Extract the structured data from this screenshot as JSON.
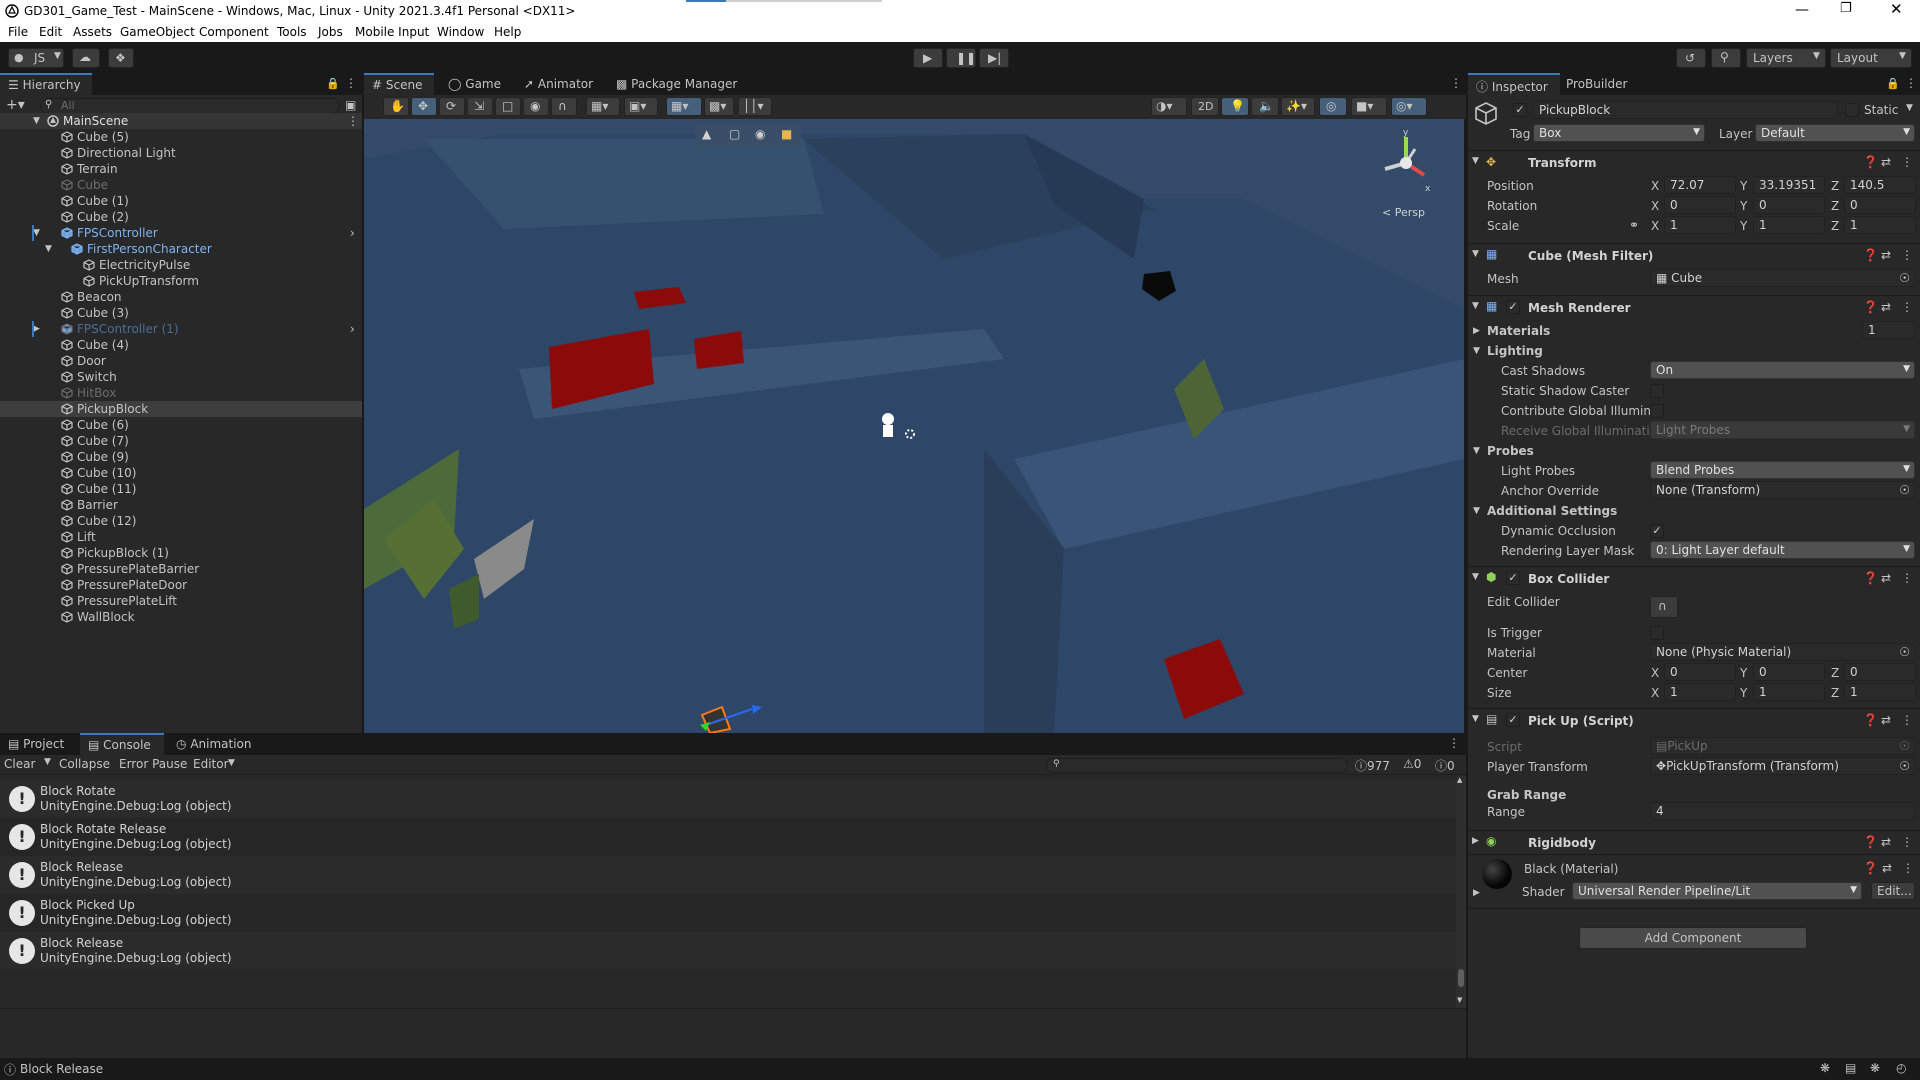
{
  "window": {
    "title": "GD301_Game_Test - MainScene - Windows, Mac, Linux - Unity 2021.3.4f1 Personal <DX11>"
  },
  "menu": [
    "File",
    "Edit",
    "Assets",
    "GameObject",
    "Component",
    "Tools",
    "Jobs",
    "Mobile Input",
    "Window",
    "Help"
  ],
  "toolbar": {
    "account": "JS",
    "layers": "Layers",
    "layout": "Layout"
  },
  "hierarchy": {
    "title": "Hierarchy",
    "search_placeholder": "All",
    "scene": "MainScene",
    "items": [
      {
        "label": "Cube (5)",
        "depth": 1
      },
      {
        "label": "Directional Light",
        "depth": 1
      },
      {
        "label": "Terrain",
        "depth": 1
      },
      {
        "label": "Cube",
        "depth": 1,
        "disabled": true
      },
      {
        "label": "Cube (1)",
        "depth": 1
      },
      {
        "label": "Cube (2)",
        "depth": 1
      },
      {
        "label": "FPSController",
        "depth": 1,
        "prefab": true,
        "expanded": true
      },
      {
        "label": "FirstPersonCharacter",
        "depth": 2,
        "prefab": true,
        "expanded": true
      },
      {
        "label": "ElectricityPulse",
        "depth": 3
      },
      {
        "label": "PickUpTransform",
        "depth": 3
      },
      {
        "label": "Beacon",
        "depth": 1
      },
      {
        "label": "Cube (3)",
        "depth": 1
      },
      {
        "label": "FPSController (1)",
        "depth": 1,
        "prefab": true,
        "disabled": true,
        "collapsed": true
      },
      {
        "label": "Cube (4)",
        "depth": 1
      },
      {
        "label": "Door",
        "depth": 1
      },
      {
        "label": "Switch",
        "depth": 1
      },
      {
        "label": "HitBox",
        "depth": 1,
        "disabled": true
      },
      {
        "label": "PickupBlock",
        "depth": 1,
        "selected": true
      },
      {
        "label": "Cube (6)",
        "depth": 1
      },
      {
        "label": "Cube (7)",
        "depth": 1
      },
      {
        "label": "Cube (9)",
        "depth": 1
      },
      {
        "label": "Cube (10)",
        "depth": 1
      },
      {
        "label": "Cube (11)",
        "depth": 1
      },
      {
        "label": "Barrier",
        "depth": 1
      },
      {
        "label": "Cube (12)",
        "depth": 1
      },
      {
        "label": "Lift",
        "depth": 1
      },
      {
        "label": "PickupBlock (1)",
        "depth": 1
      },
      {
        "label": "PressurePlateBarrier",
        "depth": 1
      },
      {
        "label": "PressurePlateDoor",
        "depth": 1
      },
      {
        "label": "PressurePlateLift",
        "depth": 1
      },
      {
        "label": "WallBlock",
        "depth": 1
      }
    ]
  },
  "scene_tabs": {
    "scene": "Scene",
    "game": "Game",
    "animator": "Animator",
    "package_manager": "Package Manager"
  },
  "scene_view": {
    "mode_2d": "2D",
    "persp": "< Persp",
    "gizmo_y": "y",
    "gizmo_x": "x"
  },
  "bottom_tabs": {
    "project": "Project",
    "console": "Console",
    "animation": "Animation"
  },
  "console": {
    "clear": "Clear",
    "collapse": "Collapse",
    "error_pause": "Error Pause",
    "editor": "Editor",
    "log_count": "977",
    "warn_count": "0",
    "error_count": "0",
    "entries": [
      {
        "title": "Block Rotate",
        "detail": "UnityEngine.Debug:Log (object)"
      },
      {
        "title": "Block Rotate Release",
        "detail": "UnityEngine.Debug:Log (object)"
      },
      {
        "title": "Block Release",
        "detail": "UnityEngine.Debug:Log (object)"
      },
      {
        "title": "Block Picked Up",
        "detail": "UnityEngine.Debug:Log (object)"
      },
      {
        "title": "Block Release",
        "detail": "UnityEngine.Debug:Log (object)"
      }
    ]
  },
  "status_bar": {
    "message": "Block Release"
  },
  "inspector": {
    "tab_inspector": "Inspector",
    "tab_probuilder": "ProBuilder",
    "object_name": "PickupBlock",
    "static": "Static",
    "tag_label": "Tag",
    "tag": "Box",
    "layer_label": "Layer",
    "layer": "Default",
    "transform": {
      "title": "Transform",
      "position_label": "Position",
      "rotation_label": "Rotation",
      "scale_label": "Scale",
      "position": {
        "x": "72.07",
        "y": "33.19351",
        "z": "140.5"
      },
      "rotation": {
        "x": "0",
        "y": "0",
        "z": "0"
      },
      "scale": {
        "x": "1",
        "y": "1",
        "z": "1"
      }
    },
    "mesh_filter": {
      "title": "Cube (Mesh Filter)",
      "mesh_label": "Mesh",
      "mesh": "Cube"
    },
    "mesh_renderer": {
      "title": "Mesh Renderer",
      "materials_label": "Materials",
      "materials_count": "1",
      "lighting_label": "Lighting",
      "cast_shadows_label": "Cast Shadows",
      "cast_shadows": "On",
      "static_shadow_caster_label": "Static Shadow Caster",
      "contribute_gi_label": "Contribute Global Illuminat",
      "receive_gi_label": "Receive Global Illuminatior",
      "receive_gi": "Light Probes",
      "probes_label": "Probes",
      "light_probes_label": "Light Probes",
      "light_probes": "Blend Probes",
      "anchor_override_label": "Anchor Override",
      "anchor_override": "None (Transform)",
      "additional_settings_label": "Additional Settings",
      "dynamic_occlusion_label": "Dynamic Occlusion",
      "rendering_layer_mask_label": "Rendering Layer Mask",
      "rendering_layer_mask": "0: Light Layer default"
    },
    "box_collider": {
      "title": "Box Collider",
      "edit_collider_label": "Edit Collider",
      "is_trigger_label": "Is Trigger",
      "material_label": "Material",
      "material": "None (Physic Material)",
      "center_label": "Center",
      "center": {
        "x": "0",
        "y": "0",
        "z": "0"
      },
      "size_label": "Size",
      "size": {
        "x": "1",
        "y": "1",
        "z": "1"
      }
    },
    "pickup_script": {
      "title": "Pick Up (Script)",
      "script_label": "Script",
      "script": "PickUp",
      "player_transform_label": "Player Transform",
      "player_transform": "PickUpTransform (Transform)",
      "grab_range_header": "Grab Range",
      "range_label": "Range",
      "range": "4"
    },
    "rigidbody": {
      "title": "Rigidbody"
    },
    "material": {
      "name": "Black (Material)",
      "shader_label": "Shader",
      "shader": "Universal Render Pipeline/Lit",
      "edit": "Edit..."
    },
    "add_component": "Add Component"
  },
  "axis_labels": {
    "x": "X",
    "y": "Y",
    "z": "Z"
  },
  "colors": {
    "accent": "#3a79bb",
    "selection": "#3e3e3e",
    "prefab": "#7cb3f2",
    "scene_floor": "#2f4a6e",
    "red_block": "#8b0a0a"
  }
}
